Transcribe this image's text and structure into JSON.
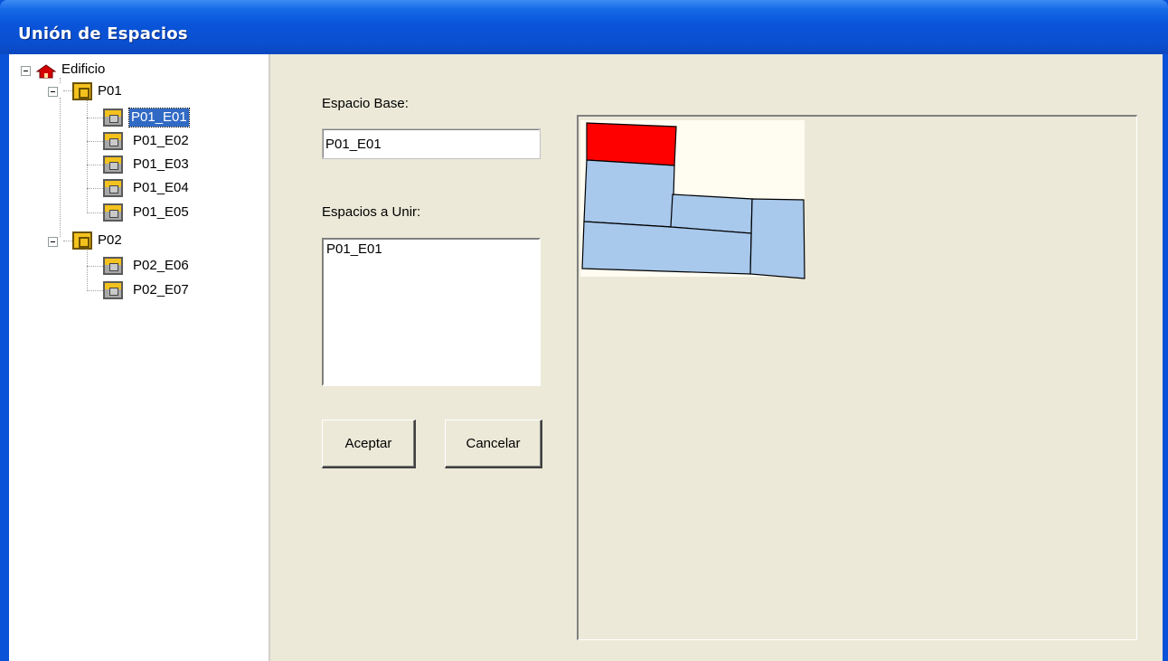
{
  "window": {
    "title": "Unión de Espacios"
  },
  "tree": {
    "root": {
      "label": "Edificio",
      "icon": "building-icon"
    },
    "floors": [
      {
        "label": "P01",
        "icon": "floor-icon",
        "spaces": [
          {
            "label": "P01_E01",
            "selected": true,
            "icon": "space-icon"
          },
          {
            "label": "P01_E02",
            "selected": false,
            "icon": "space-icon"
          },
          {
            "label": "P01_E03",
            "selected": false,
            "icon": "space-icon"
          },
          {
            "label": "P01_E04",
            "selected": false,
            "icon": "space-icon"
          },
          {
            "label": "P01_E05",
            "selected": false,
            "icon": "space-icon"
          }
        ]
      },
      {
        "label": "P02",
        "icon": "floor-icon",
        "spaces": [
          {
            "label": "P02_E06",
            "selected": false,
            "icon": "space-icon"
          },
          {
            "label": "P02_E07",
            "selected": false,
            "icon": "space-icon"
          }
        ]
      }
    ]
  },
  "form": {
    "base_label": "Espacio Base:",
    "base_value": "P01_E01",
    "join_label": "Espacios a Unir:",
    "join_items": [
      "P01_E01"
    ],
    "accept_label": "Aceptar",
    "cancel_label": "Cancelar"
  },
  "floor_plan": {
    "colors": {
      "base_space": "#ff0000",
      "other_spaces": "#a8c8ec",
      "plan_background": "#fffcf2",
      "outline": "#000000"
    }
  }
}
